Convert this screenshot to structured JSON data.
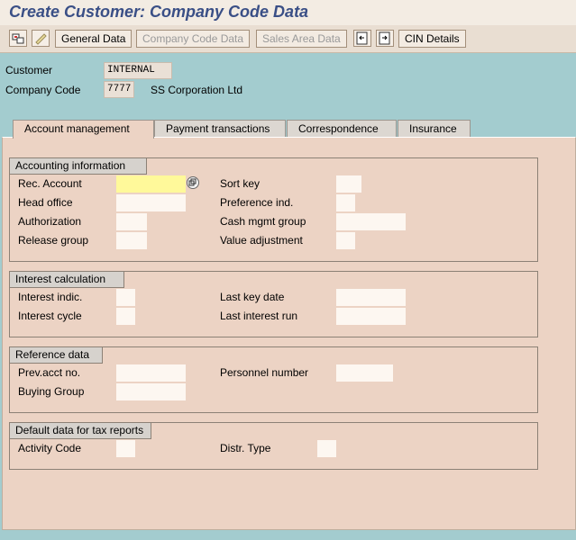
{
  "title": "Create Customer: Company Code Data",
  "toolbar": {
    "buttons": [
      "General Data",
      "Company Code Data",
      "Sales Area Data",
      "CIN Details"
    ]
  },
  "header": {
    "customer_label": "Customer",
    "customer_value": "INTERNAL",
    "company_code_label": "Company Code",
    "company_code_value": "7777",
    "company_name": "SS Corporation Ltd"
  },
  "tabs": [
    "Account management",
    "Payment transactions",
    "Correspondence",
    "Insurance"
  ],
  "groups": {
    "accounting": {
      "title": "Accounting information",
      "rec_account": "Rec. Account",
      "head_office": "Head office",
      "authorization": "Authorization",
      "release_group": "Release group",
      "sort_key": "Sort key",
      "preference_ind": "Preference ind.",
      "cash_mgmt_group": "Cash mgmt group",
      "value_adjustment": "Value adjustment"
    },
    "interest": {
      "title": "Interest calculation",
      "interest_indic": "Interest indic.",
      "interest_cycle": "Interest cycle",
      "last_key_date": "Last key date",
      "last_interest_run": "Last interest run"
    },
    "reference": {
      "title": "Reference data",
      "prev_acct_no": "Prev.acct no.",
      "buying_group": "Buying Group",
      "personnel_number": "Personnel number"
    },
    "tax": {
      "title": "Default data for tax reports",
      "activity_code": "Activity Code",
      "distr_type": "Distr. Type"
    }
  }
}
